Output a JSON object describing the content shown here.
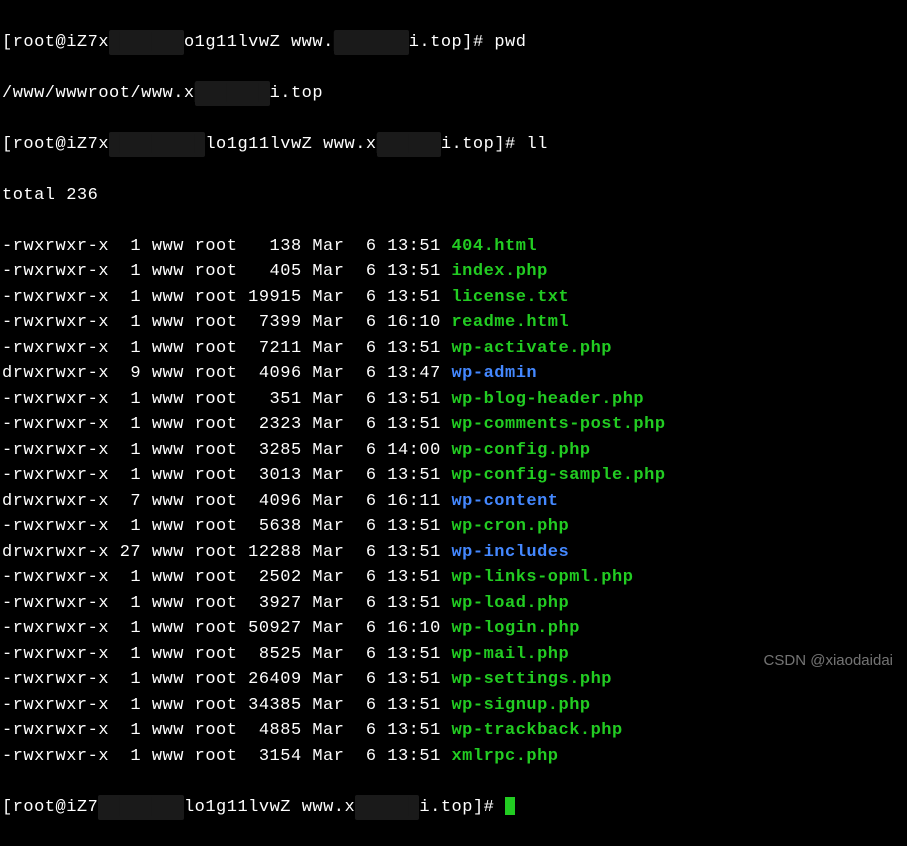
{
  "prompt1": {
    "user": "root",
    "host_prefix": "iZ7x",
    "host_hidden": "███████",
    "host_suffix": "o1g11lvwZ",
    "cwd_prefix": "www.",
    "cwd_hidden": "███████",
    "cwd_suffix": "i.top",
    "symbol": "#",
    "command": "pwd"
  },
  "pwd_output": {
    "path_prefix": "/www/wwwroot/www.x",
    "path_hidden": "███████",
    "path_suffix": "i.top"
  },
  "prompt2": {
    "user": "root",
    "host_prefix": "iZ7x",
    "host_hidden": "█████████",
    "host_suffix": "lo1g11lvwZ",
    "cwd_prefix": "www.x",
    "cwd_hidden": "██████",
    "cwd_suffix": "i.top",
    "symbol": "#",
    "command": "ll"
  },
  "total": "total 236",
  "files": [
    {
      "perms": "-rwxrwxr-x",
      "nl": " 1",
      "own": "www",
      "grp": "root",
      "size": "  138",
      "mon": "Mar",
      "day": " 6",
      "time": "13:51",
      "name": "404.html",
      "type": "file"
    },
    {
      "perms": "-rwxrwxr-x",
      "nl": " 1",
      "own": "www",
      "grp": "root",
      "size": "  405",
      "mon": "Mar",
      "day": " 6",
      "time": "13:51",
      "name": "index.php",
      "type": "file"
    },
    {
      "perms": "-rwxrwxr-x",
      "nl": " 1",
      "own": "www",
      "grp": "root",
      "size": "19915",
      "mon": "Mar",
      "day": " 6",
      "time": "13:51",
      "name": "license.txt",
      "type": "file"
    },
    {
      "perms": "-rwxrwxr-x",
      "nl": " 1",
      "own": "www",
      "grp": "root",
      "size": " 7399",
      "mon": "Mar",
      "day": " 6",
      "time": "16:10",
      "name": "readme.html",
      "type": "file"
    },
    {
      "perms": "-rwxrwxr-x",
      "nl": " 1",
      "own": "www",
      "grp": "root",
      "size": " 7211",
      "mon": "Mar",
      "day": " 6",
      "time": "13:51",
      "name": "wp-activate.php",
      "type": "file"
    },
    {
      "perms": "drwxrwxr-x",
      "nl": " 9",
      "own": "www",
      "grp": "root",
      "size": " 4096",
      "mon": "Mar",
      "day": " 6",
      "time": "13:47",
      "name": "wp-admin",
      "type": "dir"
    },
    {
      "perms": "-rwxrwxr-x",
      "nl": " 1",
      "own": "www",
      "grp": "root",
      "size": "  351",
      "mon": "Mar",
      "day": " 6",
      "time": "13:51",
      "name": "wp-blog-header.php",
      "type": "file"
    },
    {
      "perms": "-rwxrwxr-x",
      "nl": " 1",
      "own": "www",
      "grp": "root",
      "size": " 2323",
      "mon": "Mar",
      "day": " 6",
      "time": "13:51",
      "name": "wp-comments-post.php",
      "type": "file"
    },
    {
      "perms": "-rwxrwxr-x",
      "nl": " 1",
      "own": "www",
      "grp": "root",
      "size": " 3285",
      "mon": "Mar",
      "day": " 6",
      "time": "14:00",
      "name": "wp-config.php",
      "type": "file"
    },
    {
      "perms": "-rwxrwxr-x",
      "nl": " 1",
      "own": "www",
      "grp": "root",
      "size": " 3013",
      "mon": "Mar",
      "day": " 6",
      "time": "13:51",
      "name": "wp-config-sample.php",
      "type": "file"
    },
    {
      "perms": "drwxrwxr-x",
      "nl": " 7",
      "own": "www",
      "grp": "root",
      "size": " 4096",
      "mon": "Mar",
      "day": " 6",
      "time": "16:11",
      "name": "wp-content",
      "type": "dir"
    },
    {
      "perms": "-rwxrwxr-x",
      "nl": " 1",
      "own": "www",
      "grp": "root",
      "size": " 5638",
      "mon": "Mar",
      "day": " 6",
      "time": "13:51",
      "name": "wp-cron.php",
      "type": "file"
    },
    {
      "perms": "drwxrwxr-x",
      "nl": "27",
      "own": "www",
      "grp": "root",
      "size": "12288",
      "mon": "Mar",
      "day": " 6",
      "time": "13:51",
      "name": "wp-includes",
      "type": "dir"
    },
    {
      "perms": "-rwxrwxr-x",
      "nl": " 1",
      "own": "www",
      "grp": "root",
      "size": " 2502",
      "mon": "Mar",
      "day": " 6",
      "time": "13:51",
      "name": "wp-links-opml.php",
      "type": "file"
    },
    {
      "perms": "-rwxrwxr-x",
      "nl": " 1",
      "own": "www",
      "grp": "root",
      "size": " 3927",
      "mon": "Mar",
      "day": " 6",
      "time": "13:51",
      "name": "wp-load.php",
      "type": "file"
    },
    {
      "perms": "-rwxrwxr-x",
      "nl": " 1",
      "own": "www",
      "grp": "root",
      "size": "50927",
      "mon": "Mar",
      "day": " 6",
      "time": "16:10",
      "name": "wp-login.php",
      "type": "file"
    },
    {
      "perms": "-rwxrwxr-x",
      "nl": " 1",
      "own": "www",
      "grp": "root",
      "size": " 8525",
      "mon": "Mar",
      "day": " 6",
      "time": "13:51",
      "name": "wp-mail.php",
      "type": "file"
    },
    {
      "perms": "-rwxrwxr-x",
      "nl": " 1",
      "own": "www",
      "grp": "root",
      "size": "26409",
      "mon": "Mar",
      "day": " 6",
      "time": "13:51",
      "name": "wp-settings.php",
      "type": "file"
    },
    {
      "perms": "-rwxrwxr-x",
      "nl": " 1",
      "own": "www",
      "grp": "root",
      "size": "34385",
      "mon": "Mar",
      "day": " 6",
      "time": "13:51",
      "name": "wp-signup.php",
      "type": "file"
    },
    {
      "perms": "-rwxrwxr-x",
      "nl": " 1",
      "own": "www",
      "grp": "root",
      "size": " 4885",
      "mon": "Mar",
      "day": " 6",
      "time": "13:51",
      "name": "wp-trackback.php",
      "type": "file"
    },
    {
      "perms": "-rwxrwxr-x",
      "nl": " 1",
      "own": "www",
      "grp": "root",
      "size": " 3154",
      "mon": "Mar",
      "day": " 6",
      "time": "13:51",
      "name": "xmlrpc.php",
      "type": "file"
    }
  ],
  "prompt3": {
    "user": "root",
    "host_prefix": "iZ7",
    "host_hidden": "████████",
    "host_suffix": "lo1g11lvwZ",
    "cwd_prefix": "www.x",
    "cwd_hidden": "██████",
    "cwd_suffix": "i.top",
    "symbol": "#"
  },
  "watermark": "CSDN @xiaodaidai"
}
